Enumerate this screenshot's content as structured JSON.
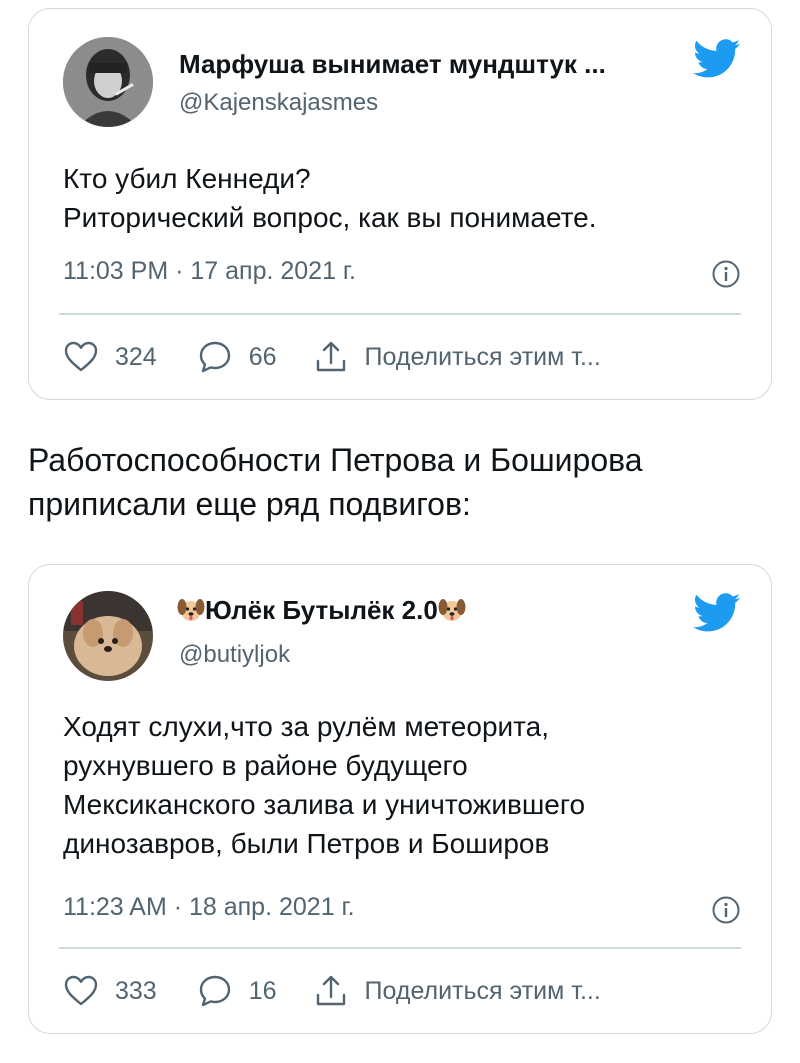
{
  "tweet1": {
    "display_name": "Марфуша вынимает мундштук ...",
    "handle": "@Kajenskajasmes",
    "text_lines": [
      "Кто убил Кеннеди?",
      "Риторический вопрос, как вы понимаете."
    ],
    "timestamp": "11:03 PM · 17 апр. 2021 г.",
    "likes": "324",
    "replies": "66",
    "share_label": "Поделиться этим т..."
  },
  "caption": {
    "lines": [
      "Работоспособности Петрова и Боширова",
      "приписали еще ряд подвигов:"
    ]
  },
  "tweet2": {
    "display_name": "Юлёк Бутылёк 2.0",
    "handle": "@butiyljok",
    "text_lines": [
      "Ходят слухи,что за рулём метеорита,",
      "рухнувшего в районе будущего",
      "Мексиканского залива и уничтожившего",
      "динозавров, были Петров и Боширов"
    ],
    "timestamp": "11:23 AM · 18 апр. 2021 г.",
    "likes": "333",
    "replies": "16",
    "share_label": "Поделиться этим т..."
  },
  "colors": {
    "text": "#0f1419",
    "secondary": "#536471",
    "border": "#cfd9de",
    "twitter_blue": "#1d9bf0"
  },
  "icons": {
    "brand": "twitter-bird-icon",
    "like": "heart-icon",
    "reply": "reply-bubble-icon",
    "share": "share-icon",
    "info": "info-icon",
    "name_emoji": "dog-face-icon"
  }
}
